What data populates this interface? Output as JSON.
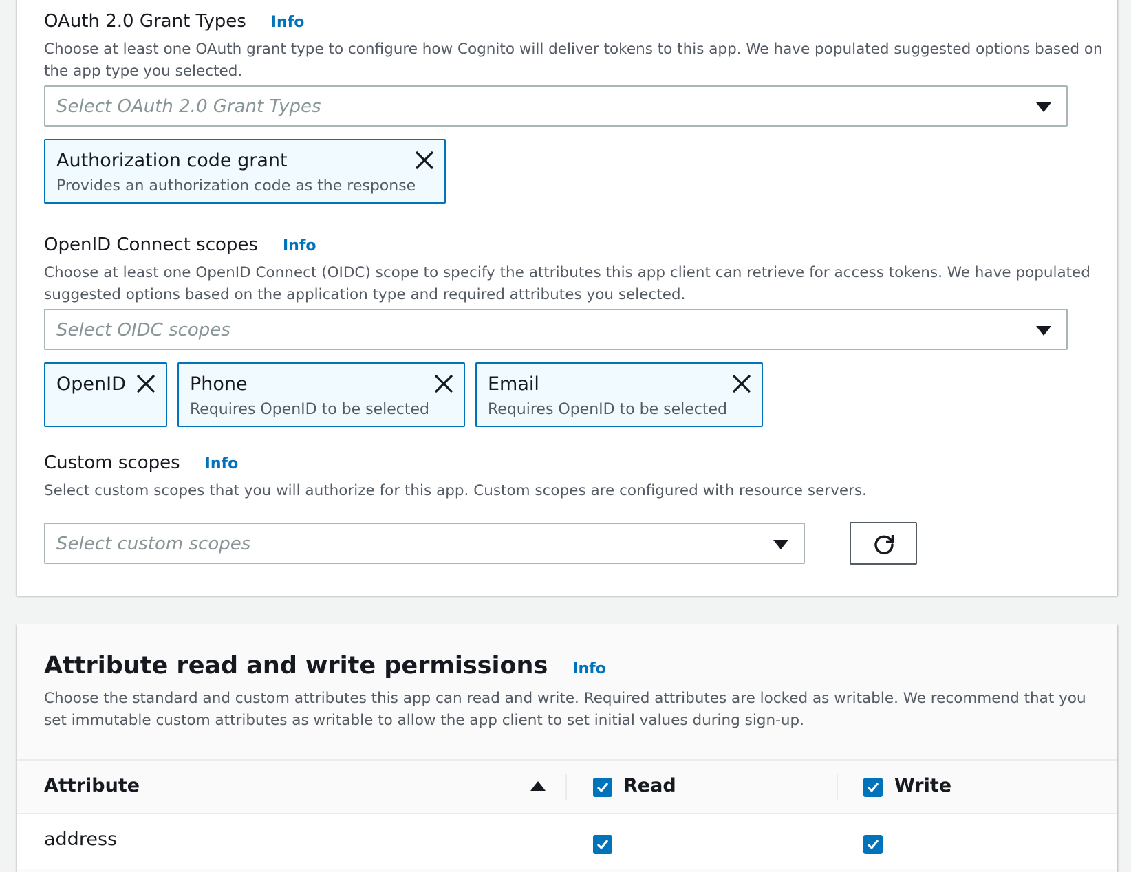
{
  "oauth": {
    "title": "OAuth 2.0 Grant Types",
    "info": "Info",
    "description": "Choose at least one OAuth grant type to configure how Cognito will deliver tokens to this app. We have populated suggested options based on the app type you selected.",
    "placeholder": "Select OAuth 2.0 Grant Types",
    "tokens": [
      {
        "label": "Authorization code grant",
        "description": "Provides an authorization code as the response"
      }
    ]
  },
  "oidc": {
    "title": "OpenID Connect scopes",
    "info": "Info",
    "description": "Choose at least one OpenID Connect (OIDC) scope to specify the attributes this app client can retrieve for access tokens. We have populated suggested options based on the application type and required attributes you selected.",
    "placeholder": "Select OIDC scopes",
    "tokens": [
      {
        "label": "OpenID",
        "description": ""
      },
      {
        "label": "Phone",
        "description": "Requires OpenID to be selected"
      },
      {
        "label": "Email",
        "description": "Requires OpenID to be selected"
      }
    ]
  },
  "custom": {
    "title": "Custom scopes",
    "info": "Info",
    "description": "Select custom scopes that you will authorize for this app. Custom scopes are configured with resource servers.",
    "placeholder": "Select custom scopes",
    "refresh_icon": "refresh-icon"
  },
  "permissions": {
    "title": "Attribute read and write permissions",
    "info": "Info",
    "description": "Choose the standard and custom attributes this app can read and write. Required attributes are locked as writable. We recommend that you set immutable custom attributes as writable to allow the app client to set initial values during sign-up.",
    "columns": {
      "attribute": "Attribute",
      "read": "Read",
      "write": "Write"
    },
    "header_read_checked": true,
    "header_write_checked": true,
    "rows": [
      {
        "attribute": "address",
        "read": true,
        "write": true
      }
    ]
  },
  "colors": {
    "accent": "#0073bb",
    "token_bg": "#f1faff",
    "text": "#16191f",
    "muted": "#545b64"
  }
}
